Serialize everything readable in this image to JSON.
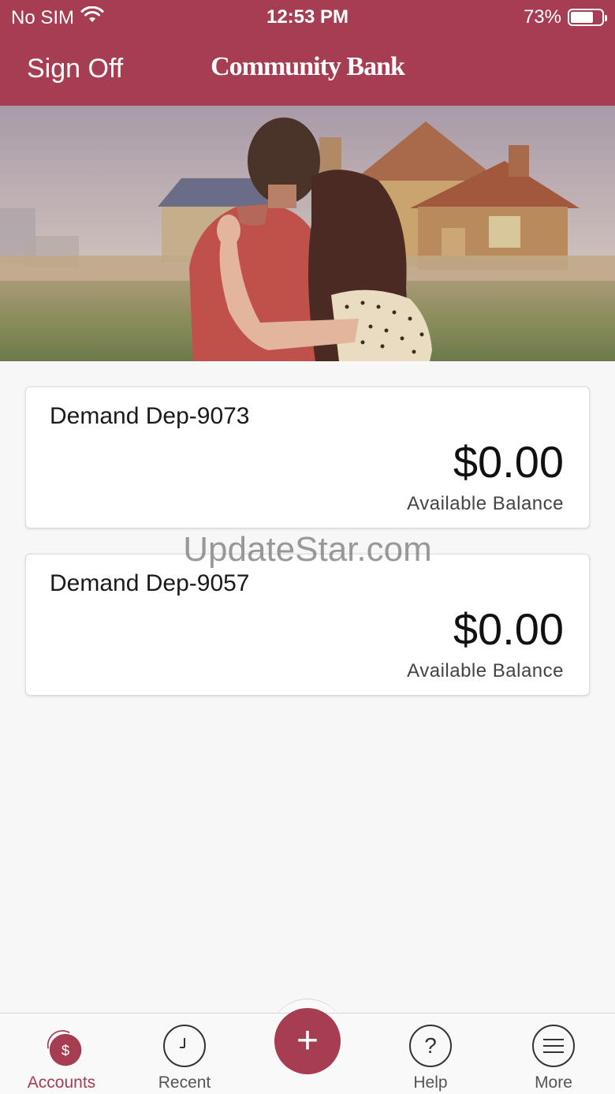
{
  "status_bar": {
    "carrier": "No SIM",
    "wifi_icon": "wifi-icon",
    "time": "12:53 PM",
    "battery_percent": "73%",
    "battery_level": 0.73
  },
  "header": {
    "sign_off_label": "Sign Off",
    "brand_name": "Community Bank",
    "background_color": "#a63d52"
  },
  "accounts": [
    {
      "name": "Demand Dep-9073",
      "balance": "$0.00",
      "balance_label": "Available Balance"
    },
    {
      "name": "Demand Dep-9057",
      "balance": "$0.00",
      "balance_label": "Available Balance"
    }
  ],
  "watermark": "UpdateStar.com",
  "tabbar": {
    "tabs": [
      {
        "label": "Accounts",
        "icon": "dollar-icon",
        "active": true
      },
      {
        "label": "Recent",
        "icon": "clock-icon",
        "active": false
      },
      {
        "label": "Help",
        "icon": "question-icon",
        "active": false
      },
      {
        "label": "More",
        "icon": "menu-icon",
        "active": false
      }
    ],
    "fab_icon": "plus-icon",
    "accent_color": "#a63d52"
  }
}
